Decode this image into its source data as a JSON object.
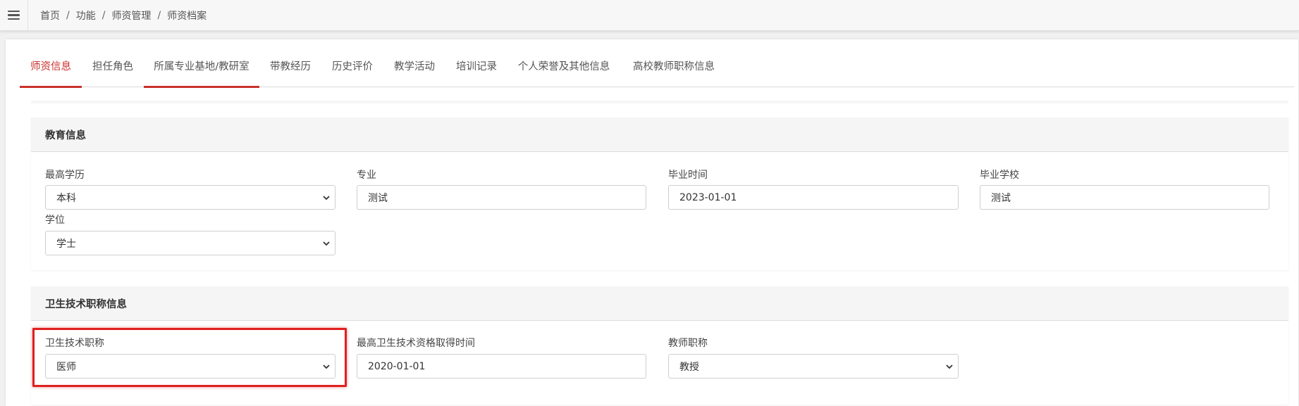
{
  "breadcrumb": {
    "items": [
      "首页",
      "功能",
      "师资管理",
      "师资档案"
    ],
    "separator": "/"
  },
  "tabs": [
    {
      "label": "师资信息",
      "active": true
    },
    {
      "label": "担任角色",
      "active": false
    },
    {
      "label": "所属专业基地/教研室",
      "active": false
    },
    {
      "label": "带教经历",
      "active": false
    },
    {
      "label": "历史评价",
      "active": false
    },
    {
      "label": "教学活动",
      "active": false
    },
    {
      "label": "培训记录",
      "active": false
    },
    {
      "label": "个人荣誉及其他信息",
      "active": false
    },
    {
      "label": "高校教师职称信息",
      "active": false
    }
  ],
  "education": {
    "title": "教育信息",
    "highest_degree": {
      "label": "最高学历",
      "value": "本科"
    },
    "major": {
      "label": "专业",
      "value": "测试"
    },
    "graduation_date": {
      "label": "毕业时间",
      "value": "2023-01-01"
    },
    "graduation_school": {
      "label": "毕业学校",
      "value": "测试"
    },
    "degree": {
      "label": "学位",
      "value": "学士"
    }
  },
  "health_title": {
    "title": "卫生技术职称信息",
    "tech_title": {
      "label": "卫生技术职称",
      "value": "医师"
    },
    "qualification_date": {
      "label": "最高卫生技术资格取得时间",
      "value": "2020-01-01"
    },
    "teacher_title": {
      "label": "教师职称",
      "value": "教授"
    }
  },
  "colors": {
    "accent": "#c9302c",
    "highlight": "#e02020"
  }
}
